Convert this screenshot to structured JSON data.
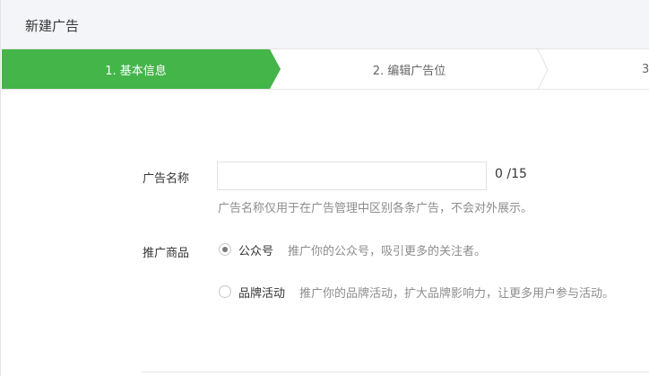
{
  "header": {
    "title": "新建广告"
  },
  "steps": [
    {
      "label": "1. 基本信息",
      "active": true
    },
    {
      "label": "2. 编辑广告位",
      "active": false
    },
    {
      "label": "3",
      "active": false
    }
  ],
  "form": {
    "name": {
      "label": "广告名称",
      "value": "",
      "placeholder": "",
      "counter": "0 /15",
      "hint": "广告名称仅用于在广告管理中区别各条广告，不会对外展示。"
    },
    "product": {
      "label": "推广商品",
      "options": [
        {
          "label": "公众号",
          "desc": "推广你的公众号，吸引更多的关注者。",
          "checked": true
        },
        {
          "label": "品牌活动",
          "desc": "推广你的品牌活动，扩大品牌影响力，让更多用户参与活动。",
          "checked": false
        }
      ]
    }
  },
  "colors": {
    "accent": "#44b549",
    "header_bg": "#f4f5f9",
    "hint": "#8d8d8d"
  }
}
